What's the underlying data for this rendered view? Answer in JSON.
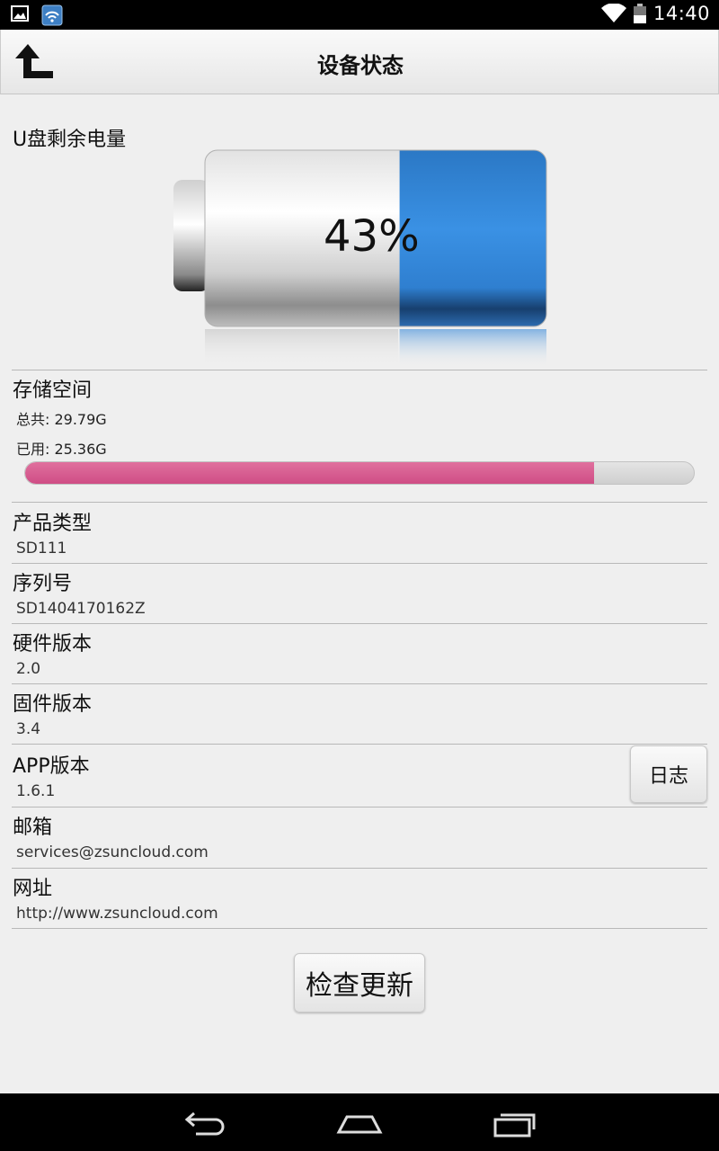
{
  "status_bar": {
    "time": "14:40",
    "icons": [
      "gallery-notification-icon",
      "wifi-app-notification-icon",
      "wifi-signal-icon",
      "battery-icon"
    ]
  },
  "header": {
    "title": "设备状态",
    "back_icon": "back-arrow-icon"
  },
  "battery": {
    "label": "U盘剩余电量",
    "percent_text": "43%",
    "level_fraction": 0.43,
    "fill_color": "#2f86d8"
  },
  "storage": {
    "label": "存储空间",
    "total_text": "总共: 29.79G",
    "used_text": "已用: 25.36G",
    "used_fraction": 0.851,
    "bar_color": "#d6508a"
  },
  "info_rows": [
    {
      "title": "产品类型",
      "value": "SD111"
    },
    {
      "title": "序列号",
      "value": "SD1404170162Z"
    },
    {
      "title": "硬件版本",
      "value": "2.0"
    },
    {
      "title": "固件版本",
      "value": "3.4"
    },
    {
      "title": "APP版本",
      "value": "1.6.1"
    },
    {
      "title": "邮箱",
      "value": "services@zsuncloud.com"
    },
    {
      "title": "网址",
      "value": "http://www.zsuncloud.com"
    }
  ],
  "buttons": {
    "log_label": "日志",
    "check_update_label": "检查更新"
  },
  "nav_bar": {
    "icons": [
      "nav-back-icon",
      "nav-home-icon",
      "nav-recents-icon"
    ]
  }
}
